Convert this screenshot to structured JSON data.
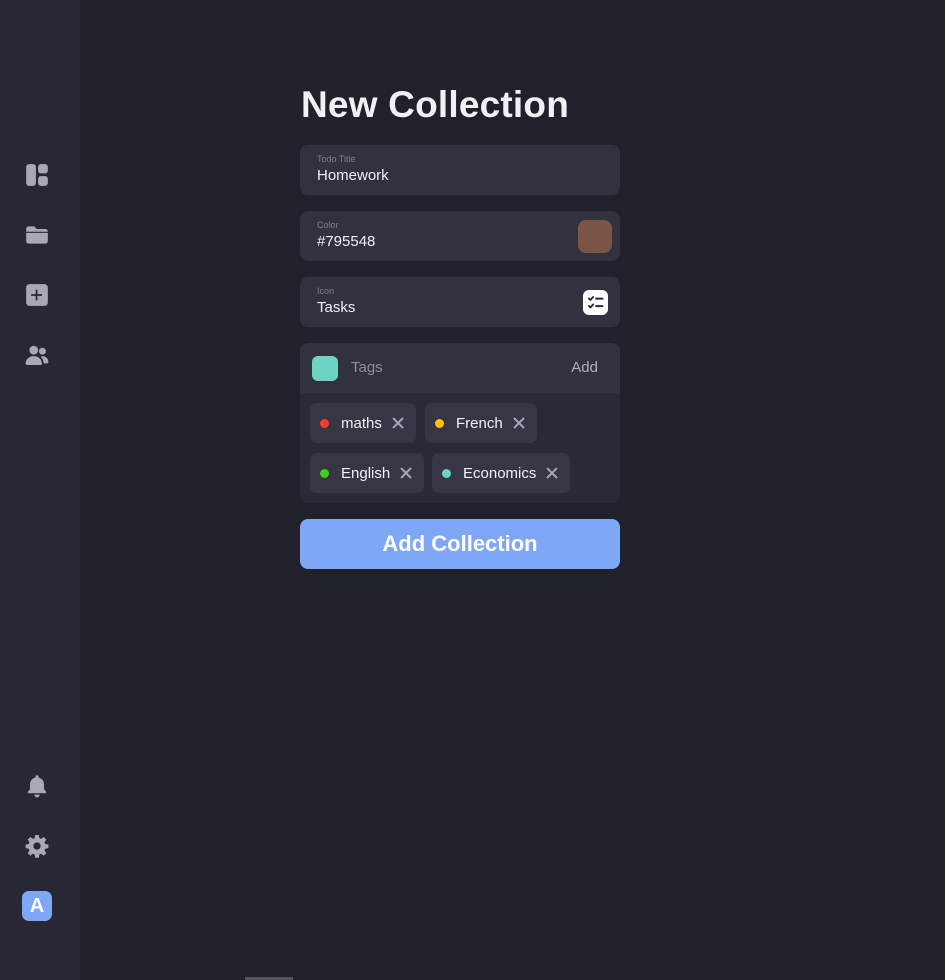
{
  "sidebar": {
    "nav": [
      {
        "icon": "dashboard-icon"
      },
      {
        "icon": "folder-icon"
      },
      {
        "icon": "add-square-icon"
      },
      {
        "icon": "users-icon"
      }
    ],
    "bottom": [
      {
        "icon": "bell-icon"
      },
      {
        "icon": "gear-icon"
      }
    ],
    "avatar_letter": "A"
  },
  "form": {
    "heading": "New Collection",
    "todo_title": {
      "label": "Todo Title",
      "value": "Homework"
    },
    "color": {
      "label": "Color",
      "value": "#795548",
      "swatch": "#795548"
    },
    "icon": {
      "label": "Icon",
      "value": "Tasks",
      "icon": "tasks-icon"
    },
    "tags": {
      "placeholder": "Tags",
      "add_label": "Add",
      "picker_color": "#6fd3c4",
      "items": [
        {
          "label": "maths",
          "color": "#ff3b30"
        },
        {
          "label": "French",
          "color": "#ffc107"
        },
        {
          "label": "English",
          "color": "#3ecf1f"
        },
        {
          "label": "Economics",
          "color": "#6fd3c4"
        }
      ]
    },
    "submit_label": "Add Collection"
  }
}
